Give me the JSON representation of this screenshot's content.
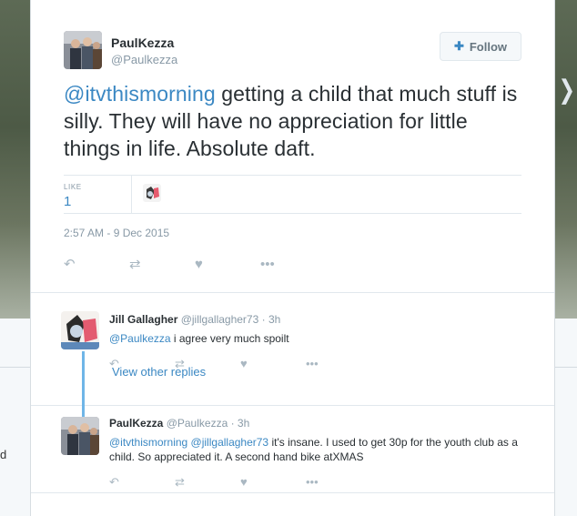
{
  "main_tweet": {
    "author_name": "PaulKezza",
    "author_handle": "@Paulkezza",
    "follow_label": "Follow",
    "text_mention": "@itvthismorning",
    "text_body": " getting a child that much stuff is silly. They will have no appreciation for little things in life.  Absolute daft.",
    "like_label": "LIKE",
    "like_count": "1",
    "timestamp": "2:57 AM - 9 Dec 2015",
    "icons": [
      "reply-icon",
      "retweet-icon",
      "heart-icon",
      "more-icon"
    ]
  },
  "replies": [
    {
      "name": "Jill Gallagher",
      "meta": " @jillgallagher73 · 3h",
      "mention": "@Paulkezza",
      "text": " i agree very much spoilt",
      "view_other": "View other replies"
    },
    {
      "name": "PaulKezza",
      "meta": " @Paulkezza · 3h",
      "mention": "@itvthismorning @jillgallagher73",
      "text": " it's insane.  I used to get 30p for the youth club as a child. So appreciated it. A second hand bike atXMAS"
    }
  ],
  "background": {
    "side_letter": "d"
  },
  "colors": {
    "accent": "#3b88c3",
    "thread_line": "#6fb5e7",
    "muted": "#8899a6",
    "icon": "#aab8c2"
  }
}
